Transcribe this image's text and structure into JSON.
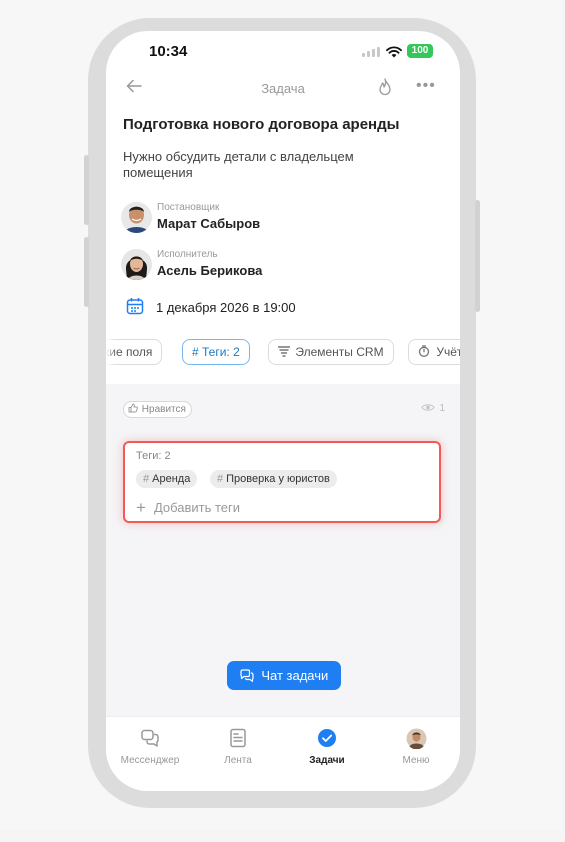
{
  "status": {
    "time": "10:34",
    "battery": "100"
  },
  "header": {
    "title": "Задача"
  },
  "task": {
    "title": "Подготовка нового договора аренды",
    "description": "Нужно обсудить детали с владельцем помещения"
  },
  "creator": {
    "role": "Постановщик",
    "name": "Марат Сабыров"
  },
  "assignee": {
    "role": "Исполнитель",
    "name": "Асель Берикова"
  },
  "deadline": {
    "text": "1 декабря 2026 в 19:00"
  },
  "tabs": [
    {
      "label": "кие поля"
    },
    {
      "label": "# Теги: 2",
      "active": true
    },
    {
      "label": "Элементы CRM"
    },
    {
      "label": "Учёт"
    }
  ],
  "reactions": {
    "like_label": "Нравится",
    "views_count": "1"
  },
  "tags_panel": {
    "header": "Теги: 2",
    "tags": [
      "Аренда",
      "Проверка у юристов"
    ],
    "add_label": "Добавить теги"
  },
  "chat_button": {
    "label": "Чат задачи"
  },
  "nav": [
    {
      "label": "Мессенджер",
      "icon": "messenger-icon"
    },
    {
      "label": "Лента",
      "icon": "feed-icon"
    },
    {
      "label": "Задачи",
      "icon": "tasks-check-icon",
      "active": true
    },
    {
      "label": "Меню",
      "icon": "menu-avatar-icon"
    }
  ],
  "colors": {
    "accent": "#1f7ff2",
    "highlight_border": "#ef5b5b",
    "battery": "#34c759",
    "active_tab": "#1e7ac2"
  }
}
